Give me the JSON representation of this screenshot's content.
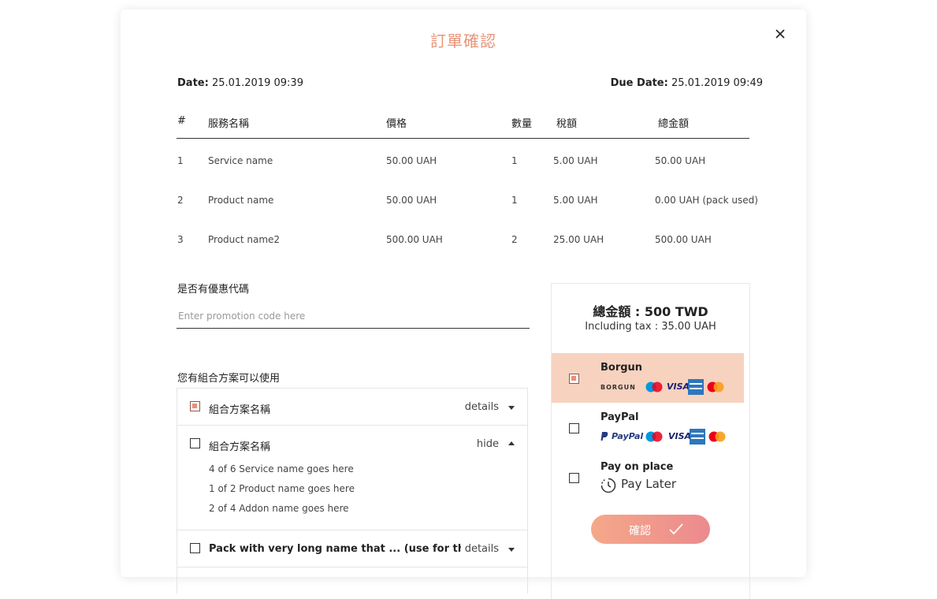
{
  "modal": {
    "title": "訂單確認",
    "close_label": "×"
  },
  "dates": {
    "date_label": "Date:",
    "date_value": "25.01.2019  09:39",
    "due_label": "Due Date:",
    "due_value": "25.01.2019  09:49"
  },
  "table": {
    "headers": [
      "#",
      "服務名稱",
      "價格",
      "數量",
      "稅額",
      "總金額"
    ],
    "rows": [
      [
        "1",
        "Service name",
        "50.00 UAH",
        "1",
        "5.00 UAH",
        "50.00 UAH"
      ],
      [
        "2",
        "Product name",
        "50.00 UAH",
        "1",
        "5.00 UAH",
        "0.00 UAH (pack used)"
      ],
      [
        "3",
        "Product name2",
        "500.00 UAH",
        "2",
        "25.00 UAH",
        "500.00 UAH"
      ]
    ]
  },
  "promo": {
    "label": "是否有優惠代碼",
    "placeholder": "Enter promotion code here",
    "value": ""
  },
  "packages": {
    "label": "您有組合方案可以使用",
    "items": [
      {
        "name": "組合方案名稱",
        "action": "details",
        "checked": true
      },
      {
        "name": "組合方案名稱",
        "action": "hide",
        "checked": false,
        "details": [
          "4 of 6 Service name goes here",
          "1 of 2 Product name goes here",
          "2 of 4 Addon name goes here"
        ]
      },
      {
        "name": "Pack with very long name that ... (use for this offer)",
        "action": "details",
        "checked": false
      }
    ]
  },
  "summary": {
    "total": "總金額 : 500 TWD",
    "tax": "Including tax : 35.00 UAH",
    "payment_methods": [
      {
        "name": "Borgun",
        "selected": true,
        "brand_text": "BORGUN"
      },
      {
        "name": "PayPal",
        "selected": false,
        "brand_text": "PayPal"
      },
      {
        "name": "Pay on place",
        "selected": false,
        "extra": "Pay Later"
      }
    ],
    "card_logos": {
      "maestro": "Maestro",
      "visa": "VISA",
      "mastercard": "MasterCard"
    }
  },
  "confirm_button": {
    "label": "確認"
  },
  "colors": {
    "accent": "#E99478",
    "selected_bg": "#F7D2BF",
    "button_start": "#F5A889",
    "button_end": "#EC8A8E"
  }
}
